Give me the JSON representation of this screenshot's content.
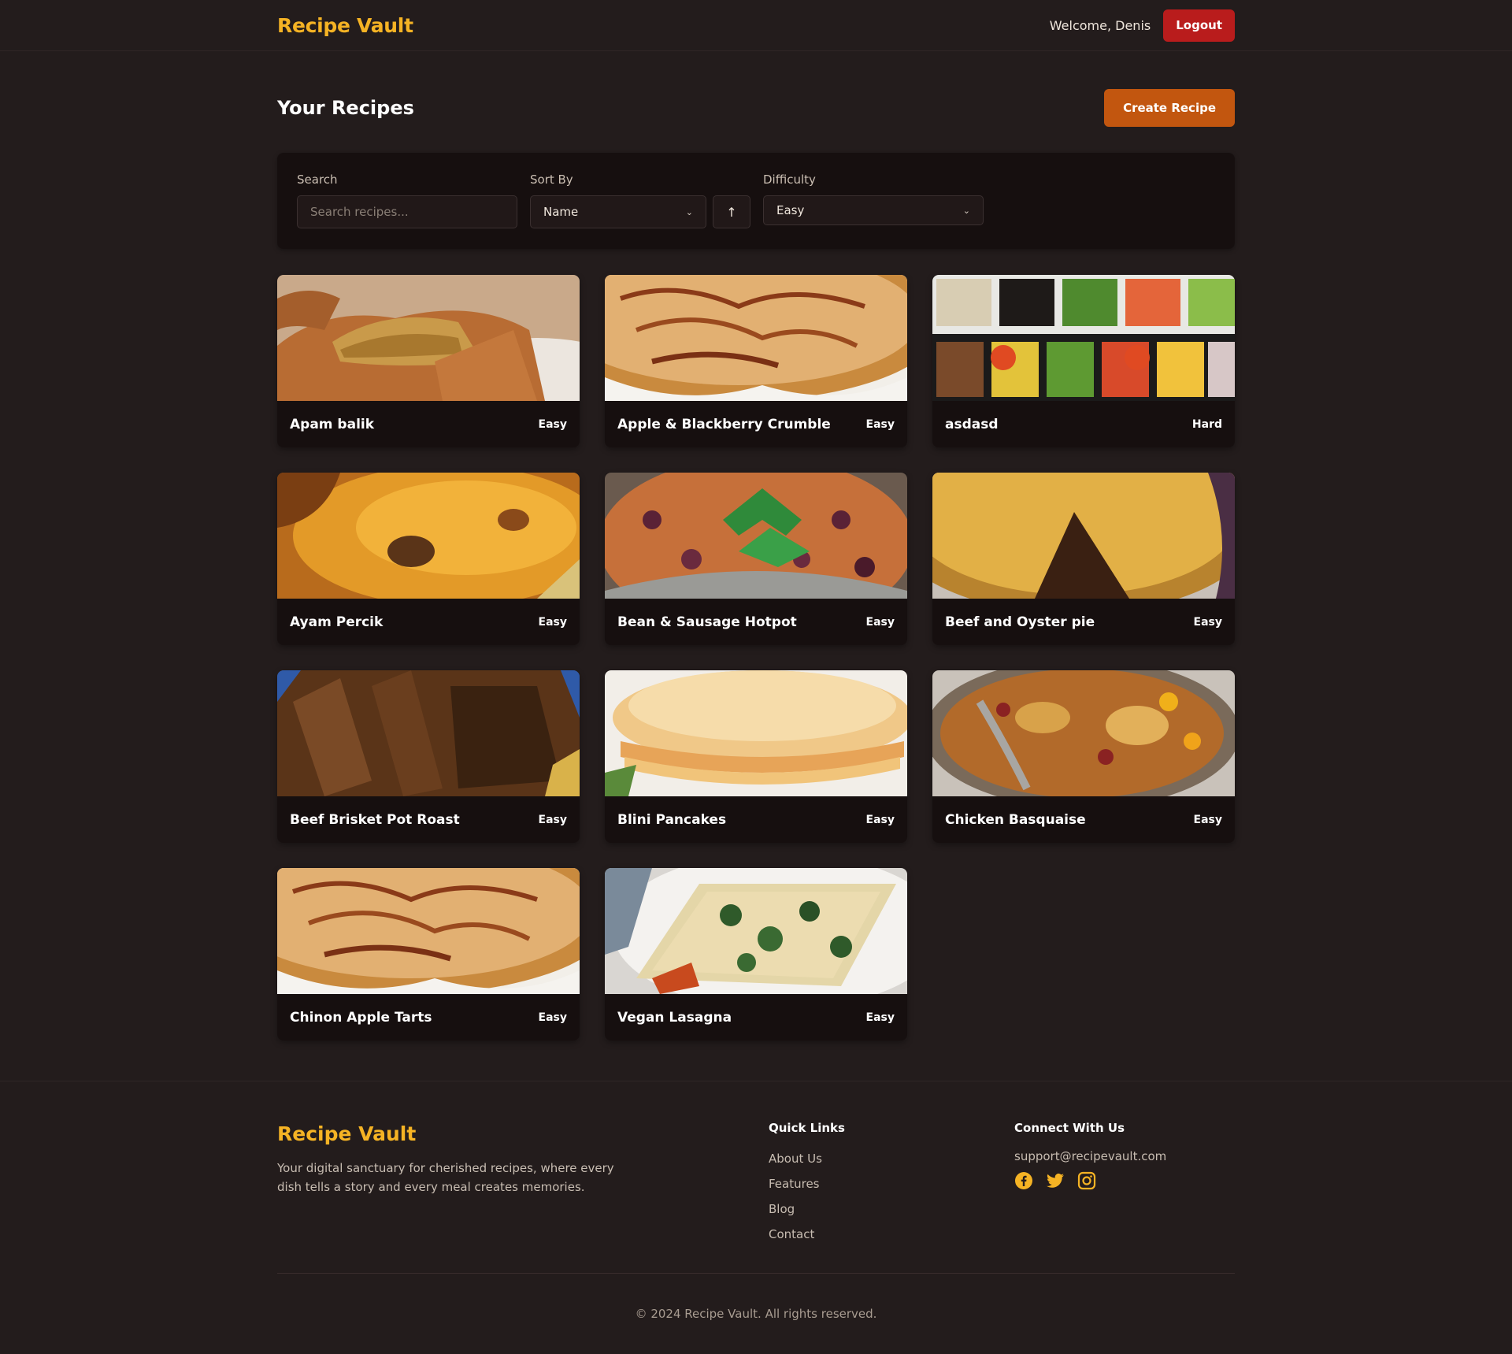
{
  "header": {
    "brand": "Recipe Vault",
    "welcome": "Welcome, Denis",
    "logout_label": "Logout"
  },
  "main": {
    "title": "Your Recipes",
    "create_label": "Create Recipe"
  },
  "filters": {
    "search_label": "Search",
    "search_placeholder": "Search recipes...",
    "sort_label": "Sort By",
    "sort_value": "Name",
    "sort_direction_icon": "arrow-up-icon",
    "difficulty_label": "Difficulty",
    "difficulty_value": "Easy"
  },
  "recipes": [
    {
      "title": "Apam balik",
      "difficulty": "Easy",
      "image": "pancake-turnover"
    },
    {
      "title": "Apple & Blackberry Crumble",
      "difficulty": "Easy",
      "image": "apple-tart"
    },
    {
      "title": "asdasd",
      "difficulty": "Hard",
      "image": "vegetable-trays"
    },
    {
      "title": "Ayam Percik",
      "difficulty": "Easy",
      "image": "grilled-chicken"
    },
    {
      "title": "Bean & Sausage Hotpot",
      "difficulty": "Easy",
      "image": "bean-stew"
    },
    {
      "title": "Beef and Oyster pie",
      "difficulty": "Easy",
      "image": "pie"
    },
    {
      "title": "Beef Brisket Pot Roast",
      "difficulty": "Easy",
      "image": "sliced-brisket"
    },
    {
      "title": "Blini Pancakes",
      "difficulty": "Easy",
      "image": "pancake-stack"
    },
    {
      "title": "Chicken Basquaise",
      "difficulty": "Easy",
      "image": "chicken-pan"
    },
    {
      "title": "Chinon Apple Tarts",
      "difficulty": "Easy",
      "image": "apple-tart"
    },
    {
      "title": "Vegan Lasagna",
      "difficulty": "Easy",
      "image": "lasagna"
    }
  ],
  "footer": {
    "brand": "Recipe Vault",
    "description": "Your digital sanctuary for cherished recipes, where every dish tells a story and every meal creates memories.",
    "quick_links_title": "Quick Links",
    "quick_links": [
      "About Us",
      "Features",
      "Blog",
      "Contact"
    ],
    "connect_title": "Connect With Us",
    "email": "support@recipevault.com",
    "social_icons": [
      "facebook-icon",
      "twitter-icon",
      "instagram-icon"
    ],
    "copyright": "© 2024 Recipe Vault. All rights reserved."
  },
  "colors": {
    "background": "#231c1c",
    "panel": "#160f0f",
    "brand": "#f5b324",
    "logout": "#b91c1c",
    "create": "#c2560f"
  }
}
